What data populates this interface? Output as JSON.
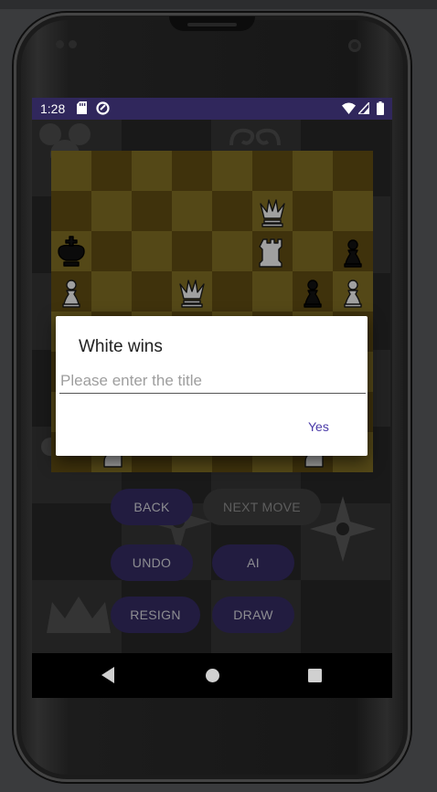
{
  "status_bar": {
    "time": "1:28",
    "icons": [
      "sd-card-icon",
      "sync-icon",
      "wifi-icon",
      "cellular-signal-icon",
      "battery-icon"
    ]
  },
  "board": {
    "light_square_color": "#7d6a23",
    "dark_square_color": "#5e4a12",
    "pieces": [
      {
        "square": "f7",
        "piece": "queen",
        "color": "white"
      },
      {
        "square": "a6",
        "piece": "king",
        "color": "black"
      },
      {
        "square": "f6",
        "piece": "rook",
        "color": "white"
      },
      {
        "square": "h6",
        "piece": "pawn",
        "color": "black"
      },
      {
        "square": "a5",
        "piece": "pawn",
        "color": "white"
      },
      {
        "square": "d5",
        "piece": "queen",
        "color": "white"
      },
      {
        "square": "g5",
        "piece": "pawn",
        "color": "black"
      },
      {
        "square": "h5",
        "piece": "pawn",
        "color": "white"
      },
      {
        "square": "b1",
        "piece": "knight",
        "color": "white"
      },
      {
        "square": "g1",
        "piece": "knight",
        "color": "white"
      }
    ]
  },
  "dialog": {
    "title": "White wins",
    "input_value": "",
    "input_placeholder": "Please enter the title",
    "confirm_label": "Yes"
  },
  "controls": {
    "back_label": "BACK",
    "next_move_label": "NEXT MOVE",
    "undo_label": "UNDO",
    "ai_label": "AI",
    "resign_label": "RESIGN",
    "draw_label": "DRAW"
  },
  "nav_bar": {
    "icons": [
      "back-triangle-icon",
      "home-circle-icon",
      "recents-square-icon"
    ]
  },
  "colors": {
    "status_bar": "#30275c",
    "button_primary": "#332a5f",
    "button_disabled": "#3b3b3b",
    "accent_text": "#4a3aa8"
  }
}
